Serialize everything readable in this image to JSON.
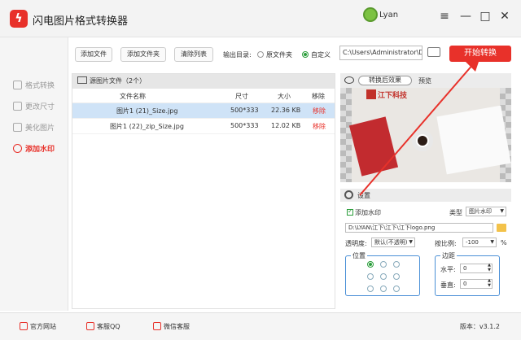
{
  "app": {
    "title": "闪电图片格式转换器",
    "logo_glyph": "ϟ",
    "user": "Lyan",
    "accent": "#e8312a"
  },
  "window_controls": {
    "menu": "≡",
    "minimize": "—",
    "maximize": "□",
    "close": "✕"
  },
  "sidebar": {
    "items": [
      {
        "label": "格式转换",
        "icon": "convert-icon",
        "active": false
      },
      {
        "label": "更改尺寸",
        "icon": "resize-icon",
        "active": false
      },
      {
        "label": "美化图片",
        "icon": "beautify-icon",
        "active": false
      },
      {
        "label": "添加水印",
        "icon": "watermark-icon",
        "active": true
      }
    ]
  },
  "toolbar": {
    "add_file": "添加文件",
    "add_folder": "添加文件夹",
    "clear_list": "清除列表",
    "output_label": "输出目录:",
    "radio_original": "原文件夹",
    "radio_custom": "自定义",
    "output_path": "C:\\Users\\Administrator\\De",
    "start": "开始转换"
  },
  "file_panel": {
    "title": "源图片文件（2个）",
    "columns": [
      "文件名称",
      "尺寸",
      "大小",
      "移除"
    ],
    "rows": [
      {
        "name": "图片1 (21)_Size.jpg",
        "dim": "500*333",
        "size": "22.36 KB",
        "remove": "移除",
        "selected": true
      },
      {
        "name": "图片1 (22)_zip_Size.jpg",
        "dim": "500*333",
        "size": "12.02 KB",
        "remove": "移除",
        "selected": false
      }
    ]
  },
  "preview": {
    "mode": "转换后效果",
    "label": "预览",
    "watermark_text": "江下科技"
  },
  "settings": {
    "title": "设置",
    "add_watermark": "添加水印",
    "type_label": "类型",
    "type_value": "图片水印",
    "path": "D:\\LYAN\\江下\\江下\\江下logo.png",
    "opacity_label": "透明度:",
    "opacity_value": "默认(不透明)",
    "scale_label": "按比例:",
    "scale_value": "-100",
    "scale_unit": "%",
    "position_title": "位置",
    "margin_title": "边距",
    "horizontal_label": "水平:",
    "horizontal_value": "0",
    "vertical_label": "垂直:",
    "vertical_value": "0"
  },
  "footer": {
    "website": "官方网站",
    "qq": "客服QQ",
    "wechat": "微信客服",
    "version": "版本：v3.1.2"
  }
}
